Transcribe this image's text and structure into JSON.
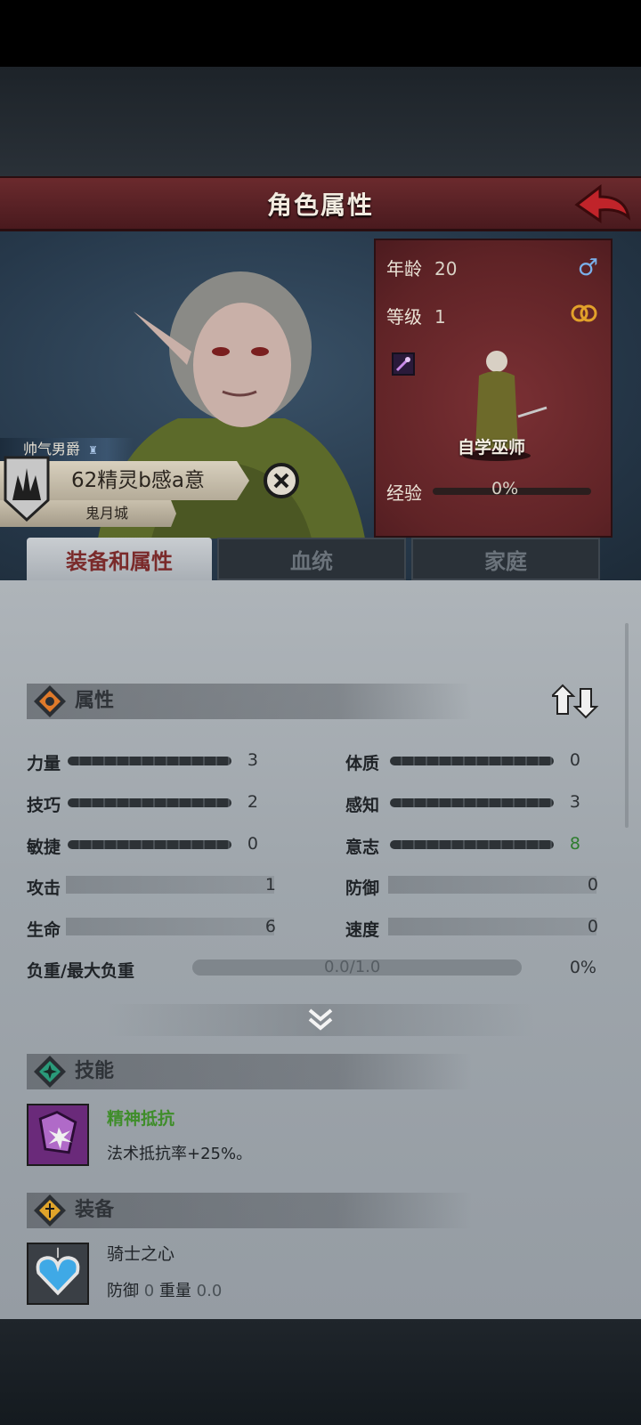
{
  "header": {
    "title": "角色属性"
  },
  "character": {
    "title_tag": "帅气男爵",
    "name": "62精灵b感a意",
    "city": "鬼月城"
  },
  "info": {
    "age_label": "年龄",
    "age_value": "20",
    "level_label": "等级",
    "level_value": "1",
    "class_name": "自学巫师",
    "exp_label": "经验",
    "exp_value": "0%"
  },
  "tabs": [
    {
      "label": "装备和属性",
      "active": true
    },
    {
      "label": "血统",
      "active": false
    },
    {
      "label": "家庭",
      "active": false
    }
  ],
  "attributes": {
    "title": "属性",
    "stats": [
      {
        "label": "力量",
        "value": "3"
      },
      {
        "label": "体质",
        "value": "0"
      },
      {
        "label": "技巧",
        "value": "2"
      },
      {
        "label": "感知",
        "value": "3"
      },
      {
        "label": "敏捷",
        "value": "0"
      },
      {
        "label": "意志",
        "value": "8"
      },
      {
        "label": "攻击",
        "value": "1"
      },
      {
        "label": "防御",
        "value": "0"
      },
      {
        "label": "生命",
        "value": "6"
      },
      {
        "label": "速度",
        "value": "0"
      }
    ],
    "load_label": "负重/最大负重",
    "load_value": "0.0/1.0",
    "load_percent": "0%"
  },
  "skills": {
    "title": "技能",
    "items": [
      {
        "name": "精神抵抗",
        "desc": "法术抵抗率+25%。"
      }
    ]
  },
  "equipment": {
    "title": "装备",
    "items": [
      {
        "name": "骑士之心",
        "defense_label": "防御",
        "defense_value": "0",
        "weight_label": "重量",
        "weight_value": "0.0"
      }
    ]
  },
  "colors": {
    "accent_red": "#5a2226",
    "skill_green": "#3f8d2a",
    "tab_active_text": "#7a2a2a"
  }
}
